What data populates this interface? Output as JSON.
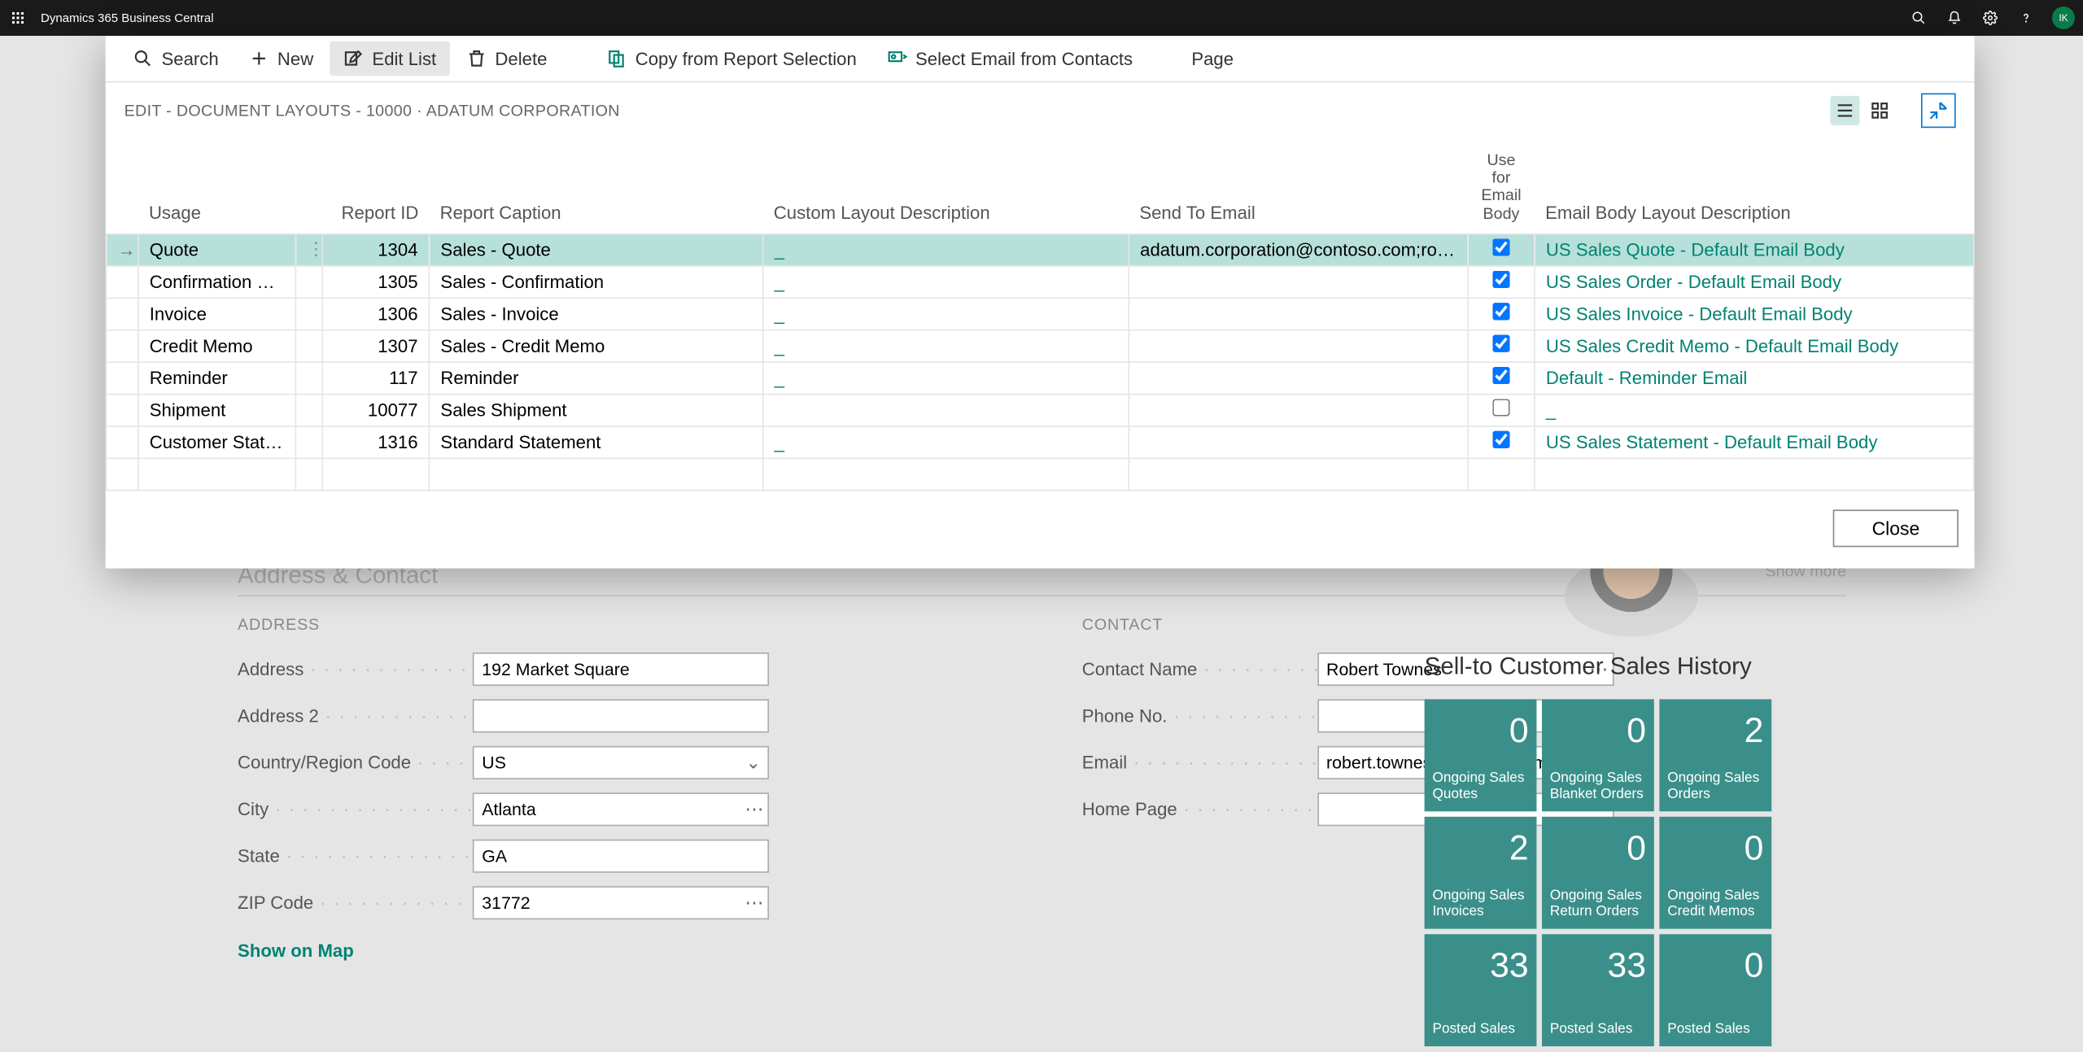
{
  "app": {
    "title": "Dynamics 365 Business Central",
    "avatar": "IK"
  },
  "modal": {
    "toolbar": {
      "search": "Search",
      "new": "New",
      "edit_list": "Edit List",
      "delete": "Delete",
      "copy": "Copy from Report Selection",
      "select_email": "Select Email from Contacts",
      "page": "Page"
    },
    "breadcrumb": "EDIT - DOCUMENT LAYOUTS - 10000 · ADATUM CORPORATION",
    "headers": {
      "usage": "Usage",
      "report_id": "Report ID",
      "report_caption": "Report Caption",
      "custom_layout": "Custom Layout Description",
      "send_to": "Send To Email",
      "use_body": "Use for Email Body",
      "body_layout": "Email Body Layout Description"
    },
    "rows": [
      {
        "usage": "Quote",
        "id": "1304",
        "caption": "Sales - Quote",
        "custom": "_",
        "email": "adatum.corporation@contoso.com;rober...",
        "use_body": true,
        "body_layout": "US Sales Quote - Default Email Body"
      },
      {
        "usage": "Confirmation Or...",
        "id": "1305",
        "caption": "Sales - Confirmation",
        "custom": "_",
        "email": "",
        "use_body": true,
        "body_layout": "US Sales Order - Default Email Body"
      },
      {
        "usage": "Invoice",
        "id": "1306",
        "caption": "Sales - Invoice",
        "custom": "_",
        "email": "",
        "use_body": true,
        "body_layout": "US Sales Invoice - Default Email Body"
      },
      {
        "usage": "Credit Memo",
        "id": "1307",
        "caption": "Sales - Credit Memo",
        "custom": "_",
        "email": "",
        "use_body": true,
        "body_layout": "US Sales Credit Memo - Default Email Body"
      },
      {
        "usage": "Reminder",
        "id": "117",
        "caption": "Reminder",
        "custom": "_",
        "email": "",
        "use_body": true,
        "body_layout": "Default - Reminder Email"
      },
      {
        "usage": "Shipment",
        "id": "10077",
        "caption": "Sales Shipment",
        "custom": "",
        "email": "",
        "use_body": false,
        "body_layout": "_"
      },
      {
        "usage": "Customer State...",
        "id": "1316",
        "caption": "Standard Statement",
        "custom": "_",
        "email": "",
        "use_body": true,
        "body_layout": "US Sales Statement - Default Email Body"
      }
    ],
    "close": "Close"
  },
  "card": {
    "section": "Address & Contact",
    "show_more": "Show more",
    "address_hdr": "ADDRESS",
    "contact_hdr": "CONTACT",
    "labels": {
      "address": "Address",
      "address2": "Address 2",
      "country": "Country/Region Code",
      "city": "City",
      "state": "State",
      "zip": "ZIP Code",
      "contact_name": "Contact Name",
      "phone": "Phone No.",
      "email": "Email",
      "home": "Home Page"
    },
    "values": {
      "address": "192 Market Square",
      "address2": "",
      "country": "US",
      "city": "Atlanta",
      "state": "GA",
      "zip": "31772",
      "contact_name": "Robert Townes",
      "phone": "",
      "email": "robert.townes@contoso.com",
      "home": ""
    },
    "show_map": "Show on Map"
  },
  "history": {
    "title": "Sell-to Customer Sales History",
    "tiles": [
      [
        {
          "n": "0",
          "l": "Ongoing Sales Quotes"
        },
        {
          "n": "0",
          "l": "Ongoing Sales Blanket Orders"
        },
        {
          "n": "2",
          "l": "Ongoing Sales Orders"
        }
      ],
      [
        {
          "n": "2",
          "l": "Ongoing Sales Invoices"
        },
        {
          "n": "0",
          "l": "Ongoing Sales Return Orders"
        },
        {
          "n": "0",
          "l": "Ongoing Sales Credit Memos"
        }
      ],
      [
        {
          "n": "33",
          "l": "Posted Sales"
        },
        {
          "n": "33",
          "l": "Posted Sales"
        },
        {
          "n": "0",
          "l": "Posted Sales"
        }
      ]
    ]
  }
}
